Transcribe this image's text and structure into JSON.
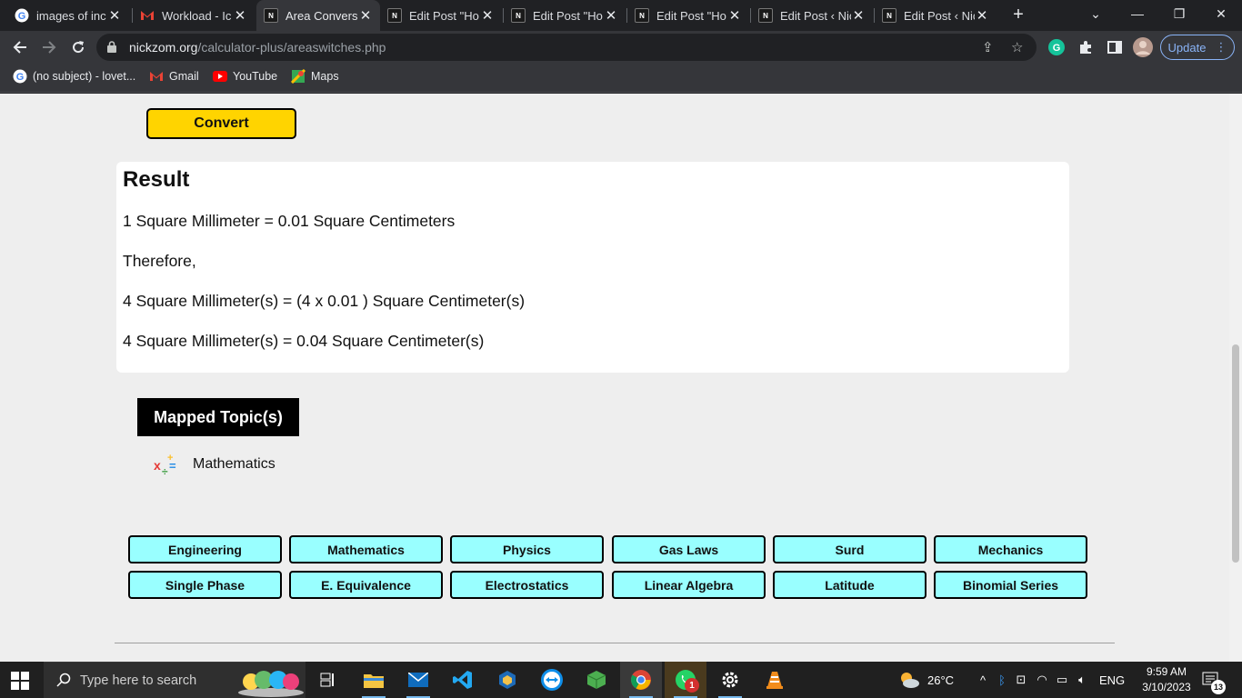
{
  "browser": {
    "tabs": [
      {
        "title": "images of inc",
        "favicon": "google-g-icon",
        "active": false
      },
      {
        "title": "Workload - Ic",
        "favicon": "gmail-icon",
        "active": false
      },
      {
        "title": "Area Convers",
        "favicon": "nickzom-icon",
        "active": true
      },
      {
        "title": "Edit Post \"Ho",
        "favicon": "nickzom-icon",
        "active": false
      },
      {
        "title": "Edit Post \"Ho",
        "favicon": "nickzom-icon",
        "active": false
      },
      {
        "title": "Edit Post \"Ho",
        "favicon": "nickzom-icon",
        "active": false
      },
      {
        "title": "Edit Post ‹ Nic",
        "favicon": "nickzom-icon",
        "active": false
      },
      {
        "title": "Edit Post ‹ Nic",
        "favicon": "nickzom-icon",
        "active": false
      }
    ],
    "url_host": "nickzom.org",
    "url_path": "/calculator-plus/areaswitches.php",
    "update_label": "Update",
    "bookmarks": [
      {
        "label": "(no subject) - lovet...",
        "icon": "google-g-icon"
      },
      {
        "label": "Gmail",
        "icon": "gmail-icon"
      },
      {
        "label": "YouTube",
        "icon": "youtube-icon"
      },
      {
        "label": "Maps",
        "icon": "maps-icon"
      }
    ]
  },
  "page": {
    "convert_label": "Convert",
    "result": {
      "heading": "Result",
      "line1": "1 Square Millimeter = 0.01  Square Centimeters",
      "line2": "Therefore,",
      "line3": "4 Square Millimeter(s) = (4 x 0.01 ) Square Centimeter(s)",
      "line4": "4 Square Millimeter(s) = 0.04 Square Centimeter(s)"
    },
    "mapped_title": "Mapped Topic(s)",
    "topic": "Mathematics",
    "link_buttons": [
      "Engineering",
      "Mathematics",
      "Physics",
      "Gas Laws",
      "Surd",
      "Mechanics",
      "Single Phase",
      "E. Equivalence",
      "Electrostatics",
      "Linear Algebra",
      "Latitude",
      "Binomial Series"
    ],
    "colors": {
      "convert": "#ffd400",
      "link_bg": "#99ffff"
    }
  },
  "taskbar": {
    "search_placeholder": "Type here to search",
    "weather": "26°C",
    "language": "ENG",
    "time": "9:59 AM",
    "date": "3/10/2023",
    "notification_count": "13",
    "whatsapp_badge": "1"
  }
}
